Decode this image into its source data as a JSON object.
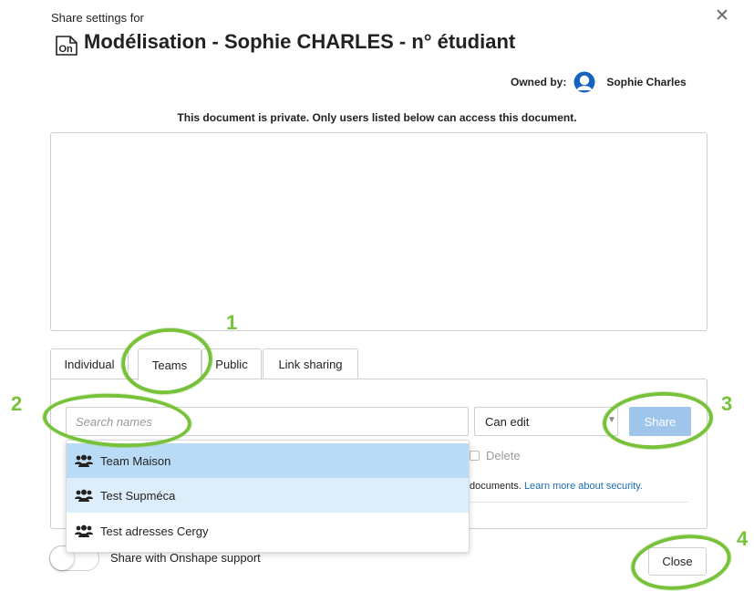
{
  "dialog": {
    "subheading": "Share settings for",
    "close_symbol": "✕",
    "document_title": "Modélisation - Sophie CHARLES - n° étudiant",
    "owned_by_label": "Owned by:",
    "owner_name": "Sophie Charles",
    "private_message": "This document is private. Only users listed below can access this document."
  },
  "tabs": [
    {
      "label": "Individual"
    },
    {
      "label": "Teams"
    },
    {
      "label": "Public"
    },
    {
      "label": "Link sharing"
    }
  ],
  "share_form": {
    "search_placeholder": "Search names",
    "search_value": "",
    "permission_selected": "Can edit",
    "share_label": "Share",
    "delete_label": "Delete",
    "security_note": "documents.",
    "security_link": "Learn more about security."
  },
  "dropdown": {
    "items": [
      {
        "label": "Team Maison"
      },
      {
        "label": "Test Supméca"
      },
      {
        "label": "Test adresses Cergy"
      }
    ]
  },
  "footer": {
    "support_toggle_label": "Share with Onshape support",
    "support_toggle_on": false,
    "close_label": "Close"
  },
  "annotations": {
    "numbers": [
      "1",
      "2",
      "3",
      "4"
    ],
    "color": "#77c23a"
  },
  "colors": {
    "share_button": "#9fc5ea",
    "dropdown_highlight": "#b9dbf6",
    "dropdown_hover": "#ddeefb",
    "link": "#1a6cb4",
    "owner_avatar": "#1565c0"
  }
}
